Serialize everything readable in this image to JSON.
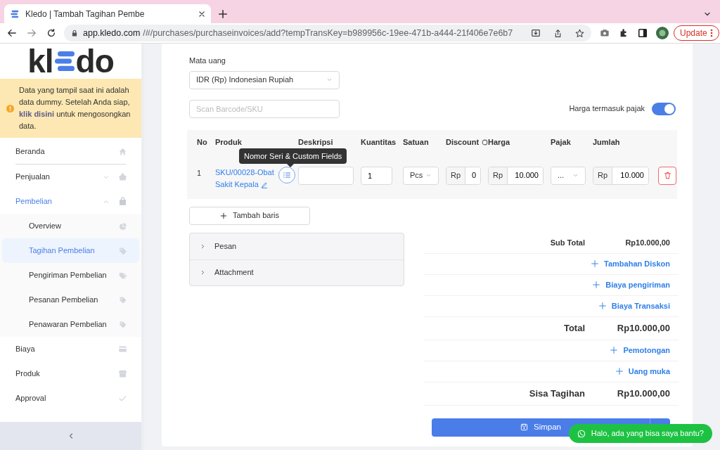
{
  "browser": {
    "tab_title": "Kledo | Tambah Tagihan Pembe",
    "url_host": "app.kledo.com",
    "url_path": "/#/purchases/purchaseinvoices/add?tempTransKey=b989956c-19ee-471b-a444-21f406e7e6b7",
    "update_button": "Update"
  },
  "sidebar": {
    "logo": {
      "left": "kl",
      "right": "do"
    },
    "notice": {
      "before": "Data yang tampil saat ini adalah data dummy. Setelah Anda siap,",
      "link": "klik disini",
      "after": "untuk mengosongkan data."
    },
    "menu": [
      {
        "label": "Beranda",
        "selected": false
      },
      {
        "label": "Penjualan",
        "selected": false,
        "expanded": false
      },
      {
        "label": "Pembelian",
        "selected": true,
        "expanded": true,
        "children": [
          {
            "label": "Overview",
            "selected": false
          },
          {
            "label": "Tagihan Pembelian",
            "selected": true
          },
          {
            "label": "Pengiriman Pembelian",
            "selected": false
          },
          {
            "label": "Pesanan Pembelian",
            "selected": false
          },
          {
            "label": "Penawaran Pembelian",
            "selected": false
          }
        ]
      },
      {
        "label": "Biaya",
        "selected": false
      },
      {
        "label": "Produk",
        "selected": false
      },
      {
        "label": "Approval",
        "selected": false
      }
    ]
  },
  "form": {
    "currency": {
      "label": "Mata uang",
      "value": "IDR (Rp) Indonesian Rupiah"
    },
    "scan": {
      "placeholder": "Scan Barcode/SKU"
    },
    "tax_inclusive": {
      "label": "Harga termasuk pajak",
      "on": true
    },
    "table": {
      "columns": [
        "No",
        "Produk",
        "Deskripsi",
        "Kuantitas",
        "Satuan",
        "Discount",
        "Harga",
        "Pajak",
        "Jumlah"
      ],
      "rows": [
        {
          "no": "1",
          "product": "SKU/00028-Obat Sakit Kepala",
          "quantity": "1",
          "unit": "Pcs",
          "discount_prefix": "Rp",
          "discount": "0",
          "price_prefix": "Rp",
          "price": "10.000",
          "tax": "...",
          "amount_prefix": "Rp",
          "amount": "10.000"
        }
      ]
    },
    "tooltip": "Nomor Seri & Custom Fields",
    "add_row_button": "Tambah baris",
    "accordion": [
      {
        "label": "Pesan",
        "expanded": false
      },
      {
        "label": "Attachment",
        "expanded": false
      }
    ],
    "summary": [
      {
        "kind": "line",
        "label": "Sub Total",
        "value": "Rp10.000,00"
      },
      {
        "kind": "link",
        "label": "Tambahan Diskon"
      },
      {
        "kind": "link",
        "label": "Biaya pengiriman"
      },
      {
        "kind": "link",
        "label": "Biaya Transaksi"
      },
      {
        "kind": "total",
        "label": "Total",
        "value": "Rp10.000,00"
      },
      {
        "kind": "link",
        "label": "Pemotongan"
      },
      {
        "kind": "link",
        "label": "Uang muka"
      },
      {
        "kind": "total",
        "label": "Sisa Tagihan",
        "value": "Rp10.000,00"
      }
    ],
    "save_button": "Simpan",
    "chat_button": "Halo, ada yang bisa saya bantu?"
  }
}
